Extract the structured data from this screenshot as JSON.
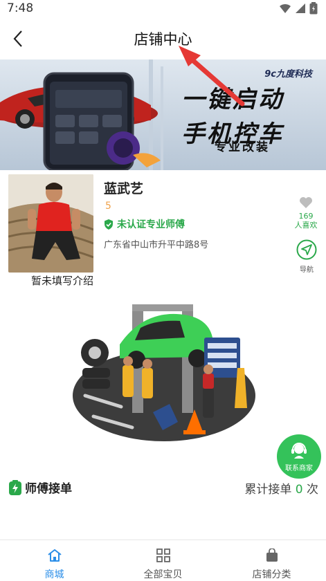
{
  "status_bar": {
    "time": "7:48",
    "icons": [
      "wifi-icon",
      "signal-icon",
      "battery-icon"
    ]
  },
  "header": {
    "title": "店铺中心",
    "back_icon": "back-arrow-icon"
  },
  "banner": {
    "brand": "9c九度科技",
    "line1": "一键启动",
    "line2": "手机控车",
    "line3": "专业改装"
  },
  "shop": {
    "name": "蓝武艺",
    "rating": "5",
    "certification": "未认证专业师傅",
    "address": "广东省中山市升平中路8号",
    "intro": "暂未填写介绍",
    "likes": {
      "count": "169",
      "label": "人喜欢"
    },
    "navigation_label": "导航"
  },
  "contact": {
    "label": "联系商家"
  },
  "orders": {
    "title": "师傅接单",
    "count_prefix": "累计接单",
    "count": "0",
    "count_suffix": "次"
  },
  "tabs": [
    {
      "label": "商城",
      "icon": "home-icon",
      "active": true
    },
    {
      "label": "全部宝贝",
      "icon": "grid-icon",
      "active": false
    },
    {
      "label": "店铺分类",
      "icon": "bag-icon",
      "active": false
    }
  ],
  "colors": {
    "accent_green": "#2aa84a",
    "contact_green": "#34c25a",
    "active_blue": "#2b8ee8",
    "rating_orange": "#f0a24a",
    "annotation_red": "#e53935"
  }
}
